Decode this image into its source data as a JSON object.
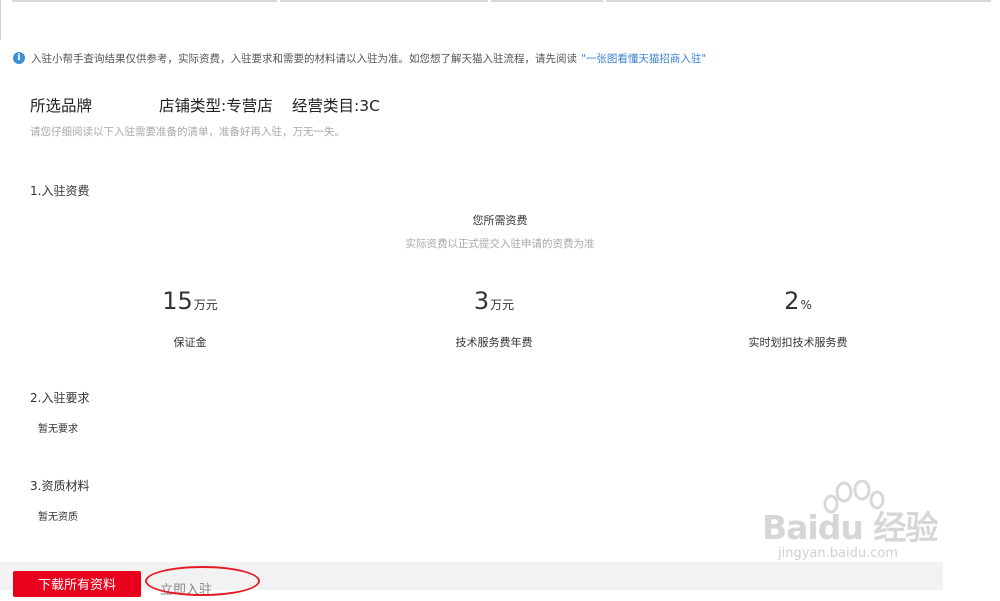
{
  "notice": {
    "text": "入驻小帮手查询结果仅供参考，实际资费，入驻要求和需要的材料请以入驻为准。如您想了解天猫入驻流程，请先阅读",
    "link": "\"一张图看懂天猫招商入驻\""
  },
  "header": {
    "brand_label": "所选品牌",
    "store_type": "店铺类型:专营店",
    "category": "经营类目:3C",
    "subtitle": "请您仔细阅读以下入驻需要准备的清单，准备好再入驻，万无一失。"
  },
  "fees": {
    "section_title": "1.入驻资费",
    "heading": "您所需资费",
    "note": "实际资费以正式提交入驻申请的资费为准",
    "items": [
      {
        "value": "15",
        "unit": "万元",
        "label": "保证金"
      },
      {
        "value": "3",
        "unit": "万元",
        "label": "技术服务费年费"
      },
      {
        "value": "2",
        "unit": "%",
        "label": "实时划扣技术服务费"
      }
    ]
  },
  "requirements": {
    "section_title": "2.入驻要求",
    "text": "暂无要求"
  },
  "materials": {
    "section_title": "3.资质材料",
    "text": "暂无资质"
  },
  "actions": {
    "download_label": "下载所有资料",
    "apply_label": "立即入驻"
  },
  "watermark": {
    "brand": "Baidu 经验",
    "url": "jingyan.baidu.com"
  },
  "colors": {
    "primary_red": "#e8001c",
    "link_blue": "#3b83d6",
    "info_blue": "#3d8fd9"
  }
}
